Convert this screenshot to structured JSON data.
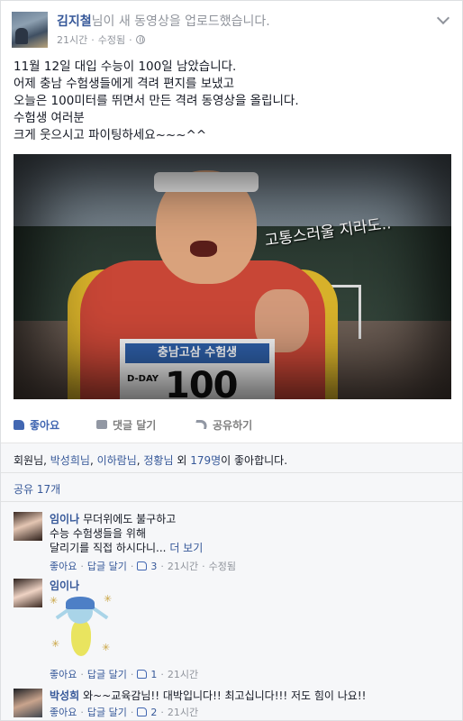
{
  "post": {
    "author": "김지철",
    "action_text": "님이 새 동영상을 업로드했습니다.",
    "time": "21시간",
    "edited": "수정됨",
    "text_lines": [
      "11월 12일 대입 수능이 100일 남았습니다.",
      "어제 충남 수험생들에게 격려 편지를 보냈고",
      "오늘은 100미터를 뛰면서 만든 격려 동영상을 올립니다.",
      "수험생 여러분",
      "크게 웃으시고 파이팅하세요~~~^^"
    ],
    "video": {
      "caption": "고통스러울 지라도..",
      "bib_title": "충남고삼 수험생",
      "bib_dday": "D-DAY",
      "bib_number": "100"
    }
  },
  "actions": {
    "like": "좋아요",
    "comment": "댓글 달기",
    "share": "공유하기"
  },
  "likes": {
    "names": [
      "회원님",
      "박성희님",
      "이하람님",
      "정황님"
    ],
    "sep": ", ",
    "outro_prefix": " 외 ",
    "others": "179명",
    "outro_suffix": "이 좋아합니다."
  },
  "shares": "공유 17개",
  "comments": [
    {
      "name": "임이나",
      "lines": [
        "무더위에도 불구하고",
        "수능 수험생들을 위해",
        "달리기를 직접 하시다니..."
      ],
      "more": "더 보기",
      "like_label": "좋아요",
      "reply_label": "답글 달기",
      "like_count": "3",
      "time": "21시간",
      "edited": "수정됨"
    },
    {
      "name": "임이나",
      "like_label": "좋아요",
      "reply_label": "답글 달기",
      "like_count": "1",
      "time": "21시간"
    },
    {
      "name": "박성희",
      "text": "와~~교육감님!! 대박입니다!! 최고십니다!!! 저도 힘이 나요!!",
      "like_label": "좋아요",
      "reply_label": "답글 달기",
      "like_count": "2",
      "time": "21시간"
    }
  ],
  "colors": {
    "link": "#365899",
    "like_blue": "#4267b2",
    "meta_gray": "#90949c"
  }
}
